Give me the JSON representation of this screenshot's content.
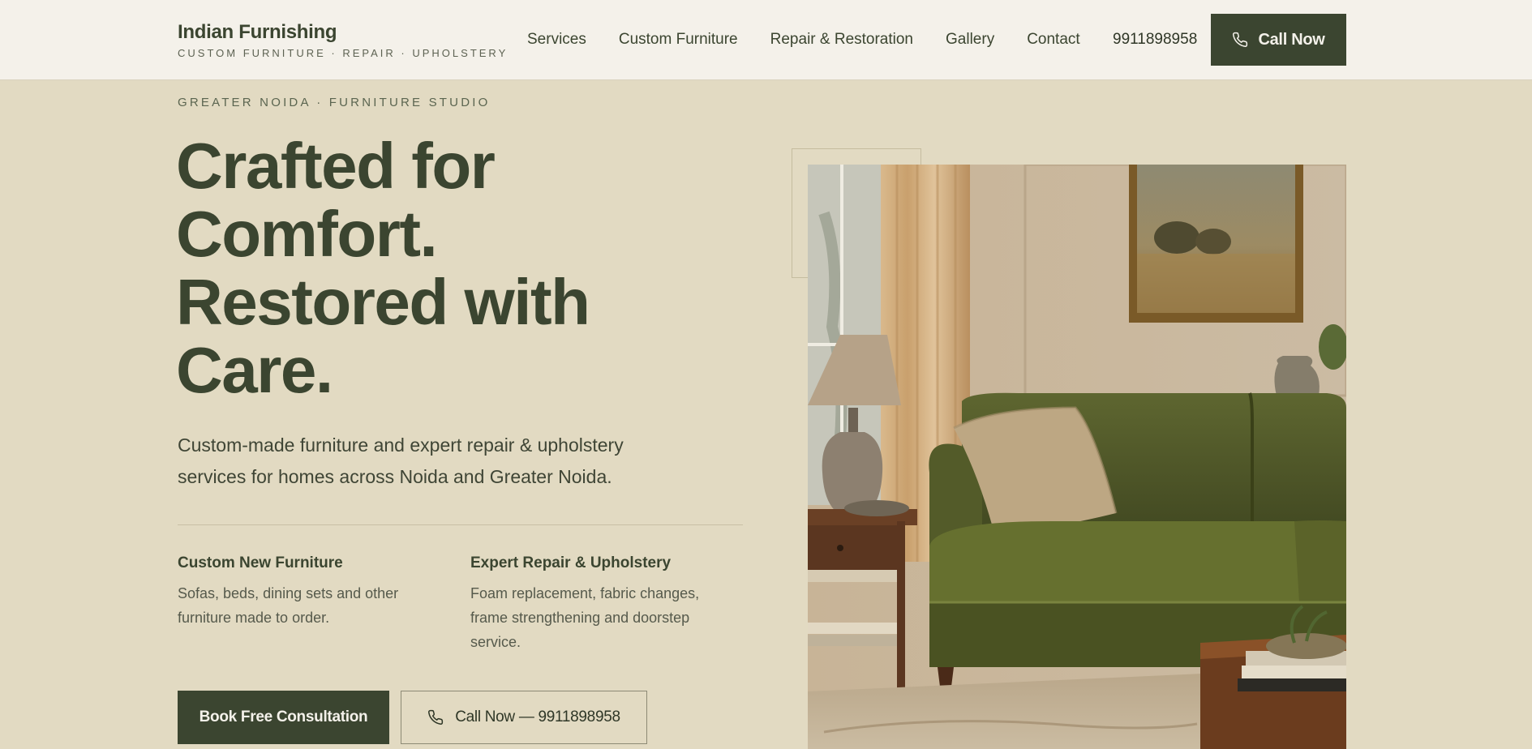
{
  "brand": {
    "name": "Indian Furnishing",
    "tagline": "CUSTOM FURNITURE · REPAIR · UPHOLSTERY"
  },
  "nav": {
    "items": [
      "Services",
      "Custom Furniture",
      "Repair & Restoration",
      "Gallery",
      "Contact"
    ],
    "phone": "9911898958",
    "cta_label": "Call Now"
  },
  "hero": {
    "eyebrow": "GREATER NOIDA · FURNITURE STUDIO",
    "headline": [
      "Crafted for",
      "Comfort.",
      "Restored with",
      "Care."
    ],
    "lede": "Custom-made furniture and expert repair & upholstery services for homes across Noida and Greater Noida.",
    "features": [
      {
        "title": "Custom New Furniture",
        "text": "Sofas, beds, dining sets and other furniture made to order."
      },
      {
        "title": "Expert Repair & Upholstery",
        "text": "Foam replacement, fabric changes, frame strengthening and doorstep service."
      }
    ],
    "primary_cta": "Book Free Consultation",
    "secondary_cta": "Call Now — 9911898958"
  },
  "colors": {
    "background": "#e2dac2",
    "header_bg": "#f4f1ea",
    "accent": "#3b4530"
  },
  "icons": {
    "phone": "phone-icon"
  }
}
